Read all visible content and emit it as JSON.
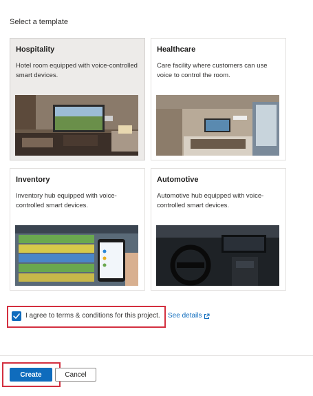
{
  "heading": "Select a template",
  "templates": [
    {
      "title": "Hospitality",
      "description": "Hotel room equipped with voice-controlled smart devices.",
      "selected": true
    },
    {
      "title": "Healthcare",
      "description": "Care facility where customers can use voice to control the room.",
      "selected": false
    },
    {
      "title": "Inventory",
      "description": "Inventory hub equipped with voice-controlled smart devices.",
      "selected": false
    },
    {
      "title": "Automotive",
      "description": "Automotive hub equipped with voice-controlled smart devices.",
      "selected": false
    }
  ],
  "agreement": {
    "checked": true,
    "label": "I agree to terms & conditions for this project.",
    "details_link": "See details",
    "link_icon": "external-link-icon"
  },
  "buttons": {
    "create": "Create",
    "cancel": "Cancel"
  },
  "colors": {
    "accent": "#0f6cbd",
    "highlight_border": "#d32f3f",
    "selected_card_bg": "#edebe9"
  }
}
